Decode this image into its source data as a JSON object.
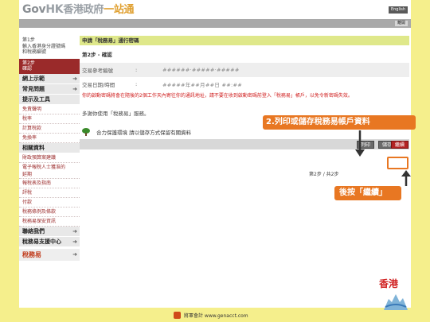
{
  "header": {
    "logo_gov": "Gov",
    "logo_hk": "HK",
    "logo_zh": "香港政府",
    "logo_accent": "一站通",
    "lang_button": "English",
    "topbar_button": "離開"
  },
  "sidebar": {
    "step1": "第1步",
    "step1_desc": "輸入香港身分證號碼\n和稅務編號",
    "step2": "第2步",
    "step2_desc": "確認",
    "items": [
      {
        "label": "網上示範",
        "type": "main",
        "arrow": "➜"
      },
      {
        "label": "常見問題",
        "type": "main",
        "arrow": "➜"
      },
      {
        "label": "提示及工具",
        "type": "main",
        "arrow": ""
      },
      {
        "label": "免責聲明",
        "type": "sub"
      },
      {
        "label": "稅率",
        "type": "sub"
      },
      {
        "label": "計算稅款",
        "type": "sub"
      },
      {
        "label": "免換率",
        "type": "sub"
      },
      {
        "label": "相關資料",
        "type": "main",
        "arrow": ""
      },
      {
        "label": "財政預算案建議",
        "type": "sub"
      },
      {
        "label": "電子報稅人士獲准的\n延期",
        "type": "sub2"
      },
      {
        "label": "報稅表及指南",
        "type": "sub"
      },
      {
        "label": "評稅",
        "type": "sub"
      },
      {
        "label": "付款",
        "type": "sub"
      },
      {
        "label": "稅務條例及條款",
        "type": "sub"
      },
      {
        "label": "稅務易保安資訊",
        "type": "sub"
      },
      {
        "label": "聯絡我們",
        "type": "main",
        "arrow": "➜"
      },
      {
        "label": "稅務易支援中心",
        "type": "main",
        "arrow": "➜"
      }
    ],
    "bottom_logo": "稅務易",
    "bottom_arrow": "➜"
  },
  "main": {
    "title": "申請「稅務易」通行密碼",
    "step_title": "第2步 - 確認",
    "rows": [
      {
        "label": "交易參考編號",
        "colon": ":",
        "value": "######·#####·#####"
      },
      {
        "label": "交易日期/時間",
        "colon": ":",
        "value": "#####年##月##日 ##:##"
      }
    ],
    "warning": "你的啟動密碼將會在隨後的2個工作天內寄往你的通訊地址，請不要在收到啟動密碼前登入「稅務易」帳戶，以免令新密碼失效。",
    "thanks": "多謝你使用「稅務易」服務。",
    "env_note": "合力保護環境 請以儲存方式保留有關資料",
    "buttons": {
      "print": "列印",
      "save": "儲存",
      "continue": "繼續"
    },
    "page_indicator": "第2步 / 共2步"
  },
  "annotations": {
    "callout1": "2.列印或儲存稅務易帳戶資料",
    "callout2": "後按「繼續」",
    "accent_color": "#e87722"
  },
  "footer": {
    "text": "將軍會計 www.genacct.com"
  },
  "badge": {
    "text": "香港"
  }
}
